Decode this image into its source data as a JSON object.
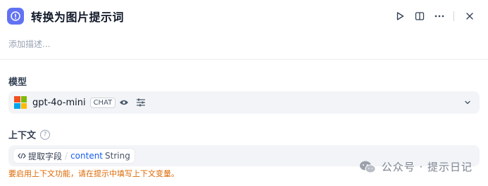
{
  "header": {
    "title": "转换为图片提示词",
    "accent": "#6172f3",
    "icons": [
      "info-icon",
      "run-icon",
      "panel-icon",
      "more-icon",
      "close-icon"
    ]
  },
  "description": {
    "placeholder": "添加描述..."
  },
  "model_section": {
    "label": "模型",
    "model_name": "gpt-4o-mini",
    "mode": "CHAT",
    "icons": [
      "microsoft-logo-icon",
      "eye-icon",
      "parameters-icon",
      "chevron-down-icon"
    ]
  },
  "context_section": {
    "label": "上下文",
    "help": "?",
    "variable": {
      "node": "提取字段",
      "separator": "/",
      "name": "content",
      "type": "String"
    },
    "warning": "要启用上下文功能，请在提示中填写上下文变量。"
  },
  "watermark": {
    "text": "公众号 · 提示日记"
  }
}
